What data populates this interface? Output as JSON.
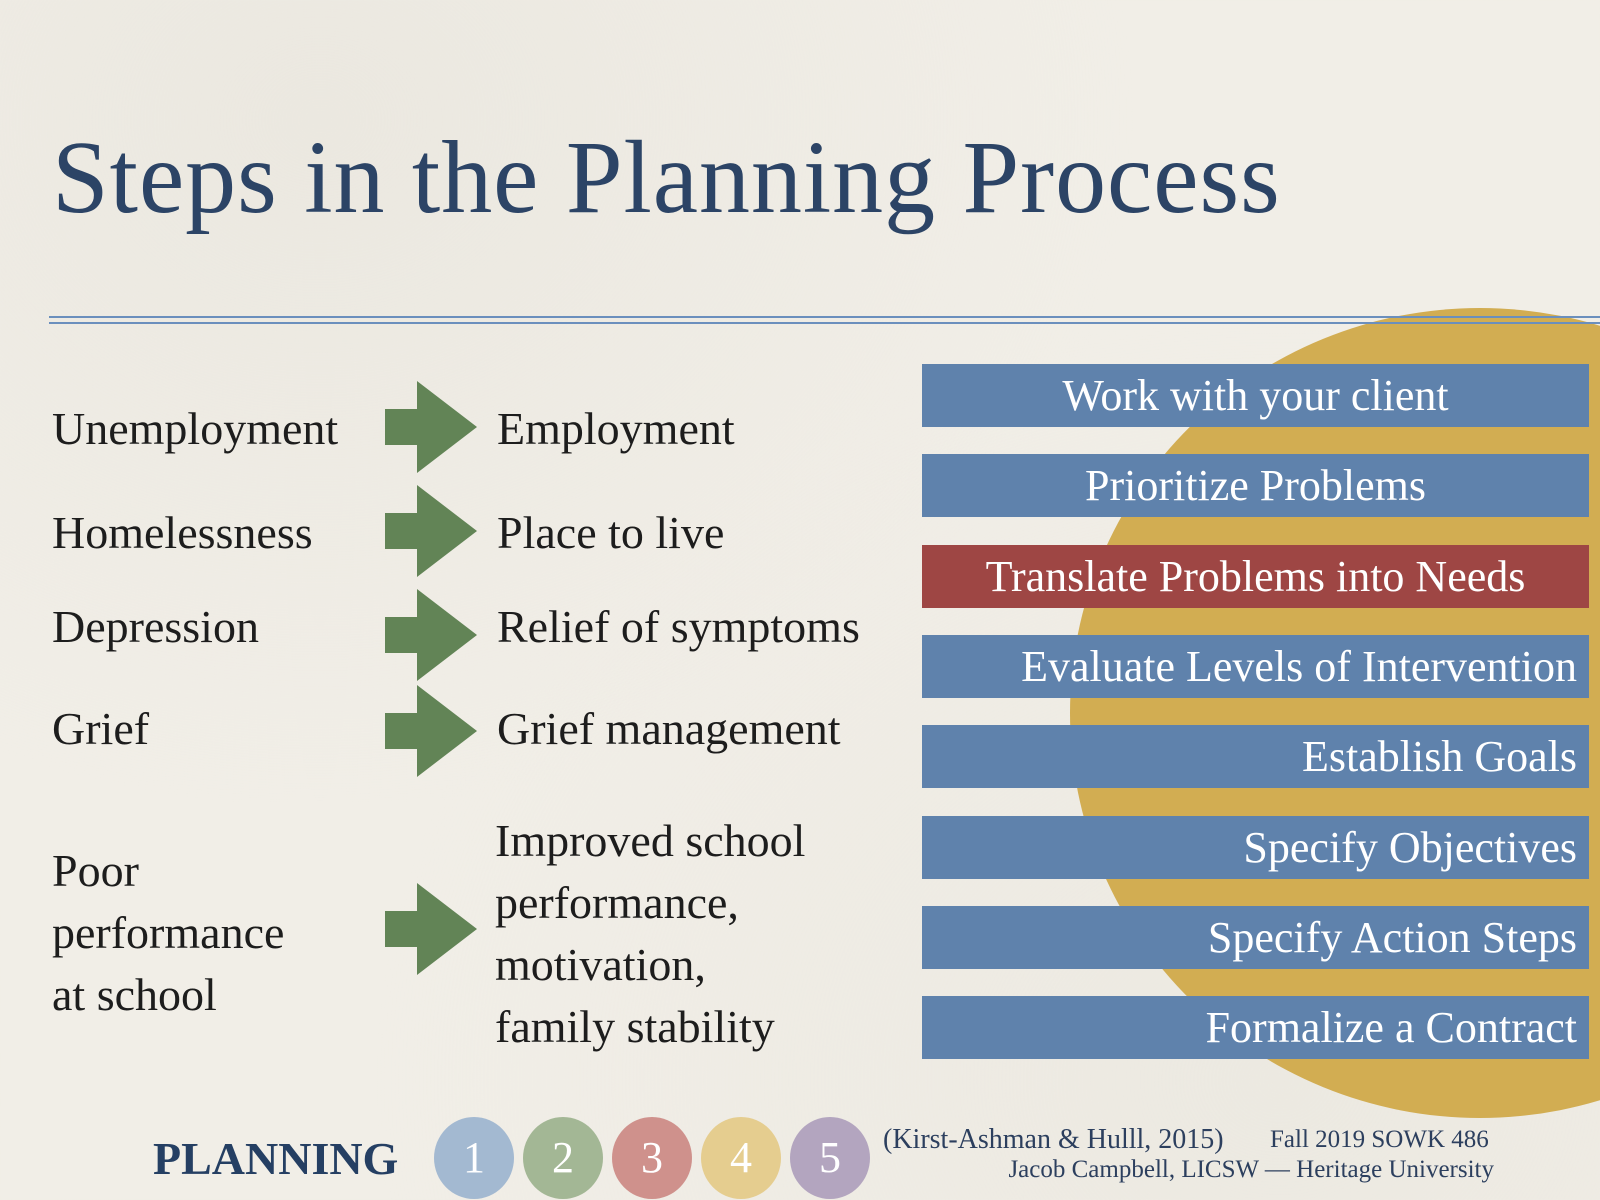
{
  "slide": {
    "title": "Steps in the Planning Process",
    "problems_to_needs": [
      {
        "problem": "Unemployment",
        "need": "Employment"
      },
      {
        "problem": "Homelessness",
        "need": "Place to live"
      },
      {
        "problem": "Depression",
        "need": "Relief of symptoms"
      },
      {
        "problem": "Grief",
        "need": "Grief management"
      },
      {
        "problem_lines": [
          "Poor",
          "performance",
          "at school"
        ],
        "need_lines": [
          "Improved school",
          "performance,",
          "motivation,",
          "family stability"
        ]
      }
    ],
    "arrow_icon": "right-arrow-icon",
    "steps": [
      {
        "label": "Work with your client",
        "active": false
      },
      {
        "label": "Prioritize Problems",
        "active": false
      },
      {
        "label": "Translate Problems into Needs",
        "active": true
      },
      {
        "label": "Evaluate Levels of Intervention",
        "active": false
      },
      {
        "label": "Establish Goals",
        "active": false
      },
      {
        "label": "Specify Objectives",
        "active": false
      },
      {
        "label": "Specify Action Steps",
        "active": false
      },
      {
        "label": "Formalize a Contract",
        "active": false
      }
    ],
    "colors": {
      "title": "#2c4466",
      "step_bg": "#5f82ac",
      "step_active_bg": "#9e4644",
      "arrow": "#628456",
      "sun": "#d2ad52"
    }
  },
  "footer": {
    "label": "PLANNING",
    "phases": [
      {
        "number": "1",
        "color": "#a3b9d1"
      },
      {
        "number": "2",
        "color": "#a3b795"
      },
      {
        "number": "3",
        "color": "#cf918c"
      },
      {
        "number": "4",
        "color": "#e5cd8f"
      },
      {
        "number": "5",
        "color": "#b3a5bf"
      }
    ],
    "citation": "(Kirst-Ashman & Hulll, 2015)",
    "course": "Fall 2019 SOWK 486",
    "author": "Jacob Campbell, LICSW — Heritage University"
  }
}
